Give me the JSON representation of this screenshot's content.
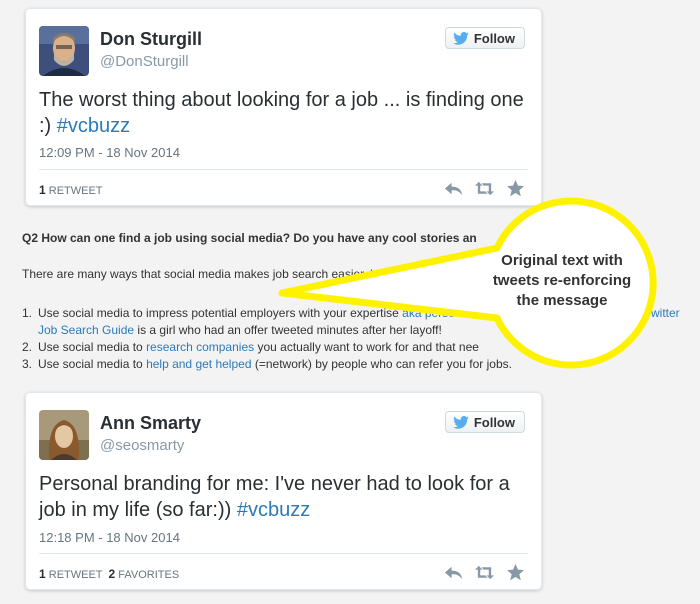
{
  "tweets": [
    {
      "name": "Don Sturgill",
      "handle": "@DonSturgill",
      "follow_label": "Follow",
      "text": "The worst thing about looking for a job ... is finding one :)",
      "hashtag": "#vcbuzz",
      "timestamp": "12:09 PM - 18 Nov 2014",
      "stats": [
        {
          "count": "1",
          "label": "RETWEET"
        }
      ]
    },
    {
      "name": "Ann Smarty",
      "handle": "@seosmarty",
      "follow_label": "Follow",
      "text": "Personal branding for me: I've never had to look for a job in my life (so far:))",
      "hashtag": "#vcbuzz",
      "timestamp": "12:18 PM - 18 Nov 2014",
      "stats": [
        {
          "count": "1",
          "label": "RETWEET"
        },
        {
          "count": "2",
          "label": "FAVORITES"
        }
      ]
    }
  ],
  "article": {
    "question": "Q2 How can one find a job using social media? Do you have any cool stories an",
    "intro": "There are many ways that social media makes job search easier, but I'll focus",
    "items": [
      {
        "num": "1.",
        "line1_before": "Use social media to impress potential employers with your expertise",
        "line1_link": "aka perso",
        "line1_tail_link": "witter",
        "line2_link": "Job Search Guide",
        "line2_after": "is a girl who had an offer tweeted minutes after her layoff!"
      },
      {
        "num": "2.",
        "before": "Use social media to",
        "link": "research companies",
        "after": "you actually want to work for and that nee"
      },
      {
        "num": "3.",
        "before": "Use social media to",
        "link": "help and get helped",
        "after": "(=network) by people who can refer you for jobs."
      }
    ]
  },
  "callout": {
    "text": "Original text with tweets re-enforcing the message",
    "fill": "#ffffff",
    "border": "#fff200"
  },
  "colors": {
    "link": "#2b7bb9",
    "twitter_bird": "#55acee",
    "action_icons": "#8899a6"
  },
  "icons": {
    "follow": "twitter-bird-icon",
    "actions": [
      "reply-icon",
      "retweet-icon",
      "favorite-icon"
    ]
  }
}
